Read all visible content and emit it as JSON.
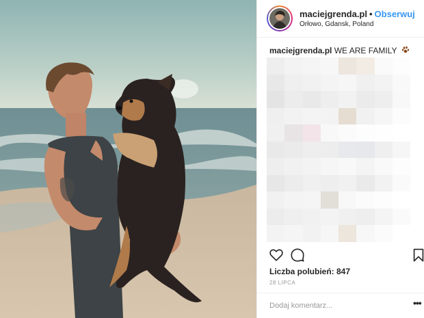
{
  "post": {
    "username": "maciejgrenda.pl",
    "separator": "•",
    "follow_label": "Obserwuj",
    "location": "Orłowo, Gdansk, Poland",
    "caption_username": "maciejgrenda.pl",
    "caption_text": "WE ARE FAMILY",
    "caption_icon": "paw-prints-emoji",
    "likes_text": "Liczba polubień: 847",
    "date": "28 LIPCA",
    "comment_placeholder": "Dodaj komentarz...",
    "more_label": "•••"
  },
  "photo": {
    "description_icon": "man-holding-dog-on-beach-photo"
  },
  "icons": {
    "like": "heart-icon",
    "comment": "comment-bubble-icon",
    "save": "bookmark-icon",
    "more": "more-options-icon"
  },
  "colors": {
    "accent": "#3897f0",
    "text": "#262626",
    "muted": "#999999",
    "border": "#efefef"
  }
}
